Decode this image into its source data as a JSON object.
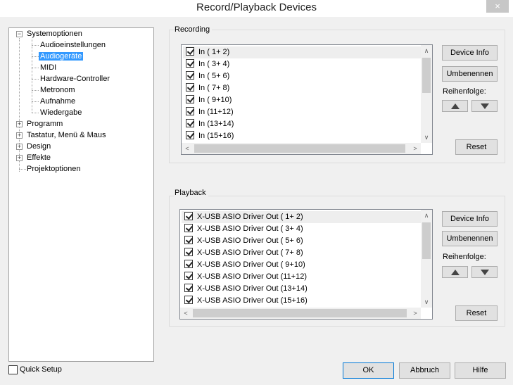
{
  "window": {
    "title": "Record/Playback Devices",
    "close_glyph": "×"
  },
  "tree": {
    "items": [
      {
        "label": "Systemoptionen",
        "expander": "−"
      },
      {
        "label": "Audioeinstellungen"
      },
      {
        "label": "Audiogeräte"
      },
      {
        "label": "MIDI"
      },
      {
        "label": "Hardware-Controller"
      },
      {
        "label": "Metronom"
      },
      {
        "label": "Aufnahme"
      },
      {
        "label": "Wiedergabe"
      },
      {
        "label": "Programm",
        "expander": "+"
      },
      {
        "label": "Tastatur, Menü & Maus",
        "expander": "+"
      },
      {
        "label": "Design",
        "expander": "+"
      },
      {
        "label": "Effekte",
        "expander": "+"
      },
      {
        "label": "Projektoptionen"
      }
    ],
    "selected": "Audiogeräte"
  },
  "recording": {
    "title": "Recording",
    "items": [
      "In ( 1+ 2)",
      "In ( 3+ 4)",
      "In ( 5+ 6)",
      "In ( 7+ 8)",
      "In ( 9+10)",
      "In (11+12)",
      "In (13+14)",
      "In (15+16)"
    ],
    "device_info": "Device Info",
    "rename": "Umbenennen",
    "order_label": "Reihenfolge:",
    "reset": "Reset"
  },
  "playback": {
    "title": "Playback",
    "items": [
      "X-USB ASIO Driver Out ( 1+ 2)",
      "X-USB ASIO Driver Out ( 3+ 4)",
      "X-USB ASIO Driver Out ( 5+ 6)",
      "X-USB ASIO Driver Out ( 7+ 8)",
      "X-USB ASIO Driver Out ( 9+10)",
      "X-USB ASIO Driver Out (11+12)",
      "X-USB ASIO Driver Out (13+14)",
      "X-USB ASIO Driver Out (15+16)"
    ],
    "device_info": "Device Info",
    "rename": "Umbenennen",
    "order_label": "Reihenfolge:",
    "reset": "Reset"
  },
  "footer": {
    "quick_setup": "Quick Setup",
    "ok": "OK",
    "cancel": "Abbruch",
    "help": "Hilfe"
  },
  "scroll_glyphs": {
    "up": "∧",
    "down": "∨",
    "left": "<",
    "right": ">"
  }
}
